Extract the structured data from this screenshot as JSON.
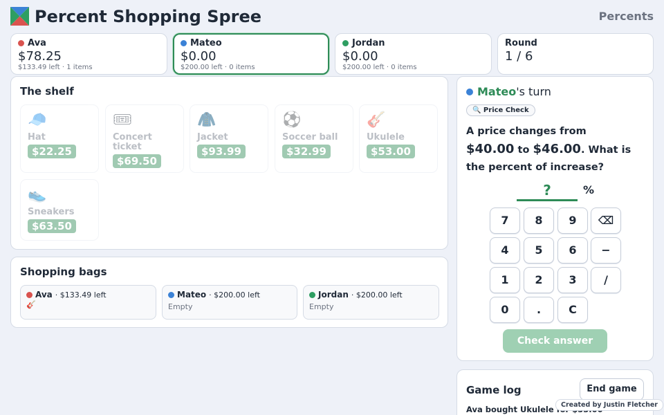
{
  "header": {
    "title": "Percent Shopping Spree",
    "subtitle": "Percents"
  },
  "colors": {
    "accent": "#2e8b57",
    "ava": "#d9534f",
    "mateo": "#3b82d6",
    "jordan": "#2e9e62"
  },
  "players": [
    {
      "name": "Ava",
      "money": "$78.25",
      "sub": "$133.49 left · 1 items",
      "color": "#d9534f"
    },
    {
      "name": "Mateo",
      "money": "$0.00",
      "sub": "$200.00 left · 0 items",
      "color": "#3b82d6"
    },
    {
      "name": "Jordan",
      "money": "$0.00",
      "sub": "$200.00 left · 0 items",
      "color": "#2e9e62"
    }
  ],
  "round": {
    "label": "Round",
    "value": "1 / 6"
  },
  "shelf": {
    "title": "The shelf",
    "items": [
      {
        "name": "Hat",
        "price": "$22.25",
        "icon": "🧢"
      },
      {
        "name": "Concert ticket",
        "price": "$69.50",
        "icon": "🎟"
      },
      {
        "name": "Jacket",
        "price": "$93.99",
        "icon": "🧥"
      },
      {
        "name": "Soccer ball",
        "price": "$32.99",
        "icon": "⚽"
      },
      {
        "name": "Ukulele",
        "price": "$53.00",
        "icon": "🎸"
      },
      {
        "name": "Sneakers",
        "price": "$63.50",
        "icon": "👟"
      }
    ]
  },
  "bags": {
    "title": "Shopping bags",
    "list": [
      {
        "name": "Ava",
        "left": "· $133.49 left",
        "contents": "🎸",
        "color": "#d9534f"
      },
      {
        "name": "Mateo",
        "left": "· $200.00 left",
        "contents": "Empty",
        "color": "#3b82d6"
      },
      {
        "name": "Jordan",
        "left": "· $200.00 left",
        "contents": "Empty",
        "color": "#2e9e62"
      }
    ]
  },
  "turn": {
    "player": "Mateo",
    "suffix": "'s turn",
    "mode": "🔍 Price Check",
    "q1": "A price changes from",
    "from": "$40.00",
    "to_word": "to",
    "to": "$46.00",
    "q2": ". What is the percent of increase?",
    "answer": "?",
    "unit": "%",
    "keys": [
      "7",
      "8",
      "9",
      "⌫",
      "4",
      "5",
      "6",
      "−",
      "1",
      "2",
      "3",
      "/",
      "0",
      ".",
      "C"
    ],
    "check_label": "Check answer"
  },
  "log": {
    "title": "Game log",
    "end_label": "End game",
    "entry": "Ava bought Ukulele for $53.00"
  },
  "credit": "Created by Justin Fletcher"
}
